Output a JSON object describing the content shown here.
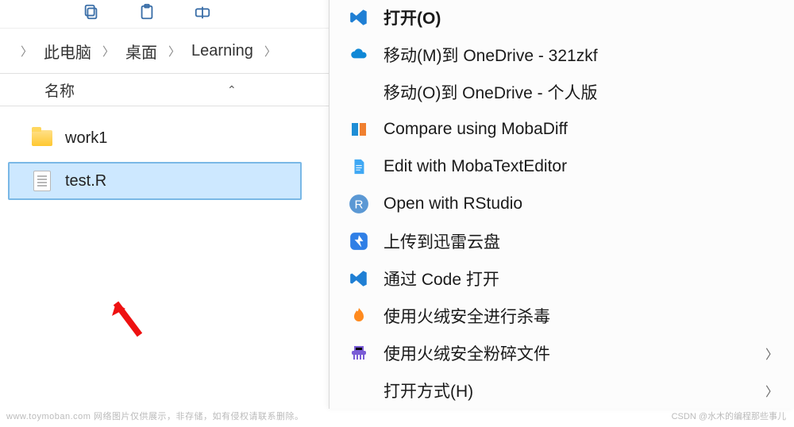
{
  "breadcrumb": {
    "items": [
      "此电脑",
      "桌面",
      "Learning"
    ]
  },
  "columns": {
    "name": "名称"
  },
  "files": [
    {
      "type": "folder",
      "label": "work1",
      "selected": false
    },
    {
      "type": "file",
      "label": "test.R",
      "selected": true
    }
  ],
  "menu": {
    "open": "打开(O)",
    "move1": "移动(M)到 OneDrive - 321zkf",
    "move2": "移动(O)到 OneDrive - 个人版",
    "compare": "Compare using MobaDiff",
    "edit": "Edit with MobaTextEditor",
    "rstudio": "Open with RStudio",
    "xunlei": "上传到迅雷云盘",
    "code": "通过 Code 打开",
    "huorong_scan": "使用火绒安全进行杀毒",
    "huorong_shred": "使用火绒安全粉碎文件",
    "openwith": "打开方式(H)"
  },
  "watermark_left": "www.toymoban.com  网络图片仅供展示，非存储，如有侵权请联系删除。",
  "watermark_right": "CSDN @水木的编程那些事儿"
}
